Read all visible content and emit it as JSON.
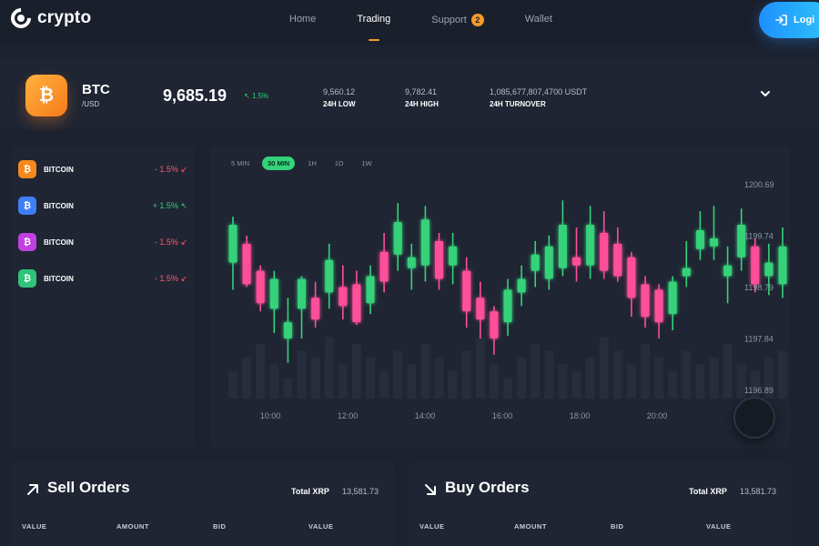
{
  "brand": {
    "name": "crypto"
  },
  "nav": {
    "items": [
      {
        "label": "Home"
      },
      {
        "label": "Trading"
      },
      {
        "label": "Support",
        "badge": "2"
      },
      {
        "label": "Wallet"
      }
    ],
    "active": "Trading"
  },
  "login": {
    "label": "Logi"
  },
  "ticker": {
    "symbol": "BTC",
    "quote": "/USD",
    "coin_icon": "bitcoin-icon",
    "price": "9,685.19",
    "change": "1.5%",
    "stats": [
      {
        "value": "9,560.12",
        "label": "24H LOW"
      },
      {
        "value": "9,782.41",
        "label": "24H HIGH"
      },
      {
        "value": "1,085,677,807,4700 USDT",
        "label": "24H TURNOVER"
      }
    ]
  },
  "watchlist": [
    {
      "name": "BITCOIN",
      "change": "- 1.5%",
      "direction": "down",
      "color": "#f5891f"
    },
    {
      "name": "BITCOIN",
      "change": "+ 1.5%",
      "direction": "up",
      "color": "#3f7ff5"
    },
    {
      "name": "BITCOIN",
      "change": "- 1.5%",
      "direction": "down",
      "color": "#c23fe0"
    },
    {
      "name": "BITCOIN",
      "change": "- 1.5%",
      "direction": "down",
      "color": "#2fc47a"
    }
  ],
  "timeframes": [
    "5 MIN",
    "30 MIN",
    "1H",
    "1D",
    "1W"
  ],
  "active_timeframe": "30 MIN",
  "colors": {
    "up": "#34d27a",
    "down": "#ff4f9a",
    "accent": "#f59a2a",
    "login": "#1e90ff"
  },
  "chart_data": {
    "type": "candlestick",
    "y_ticks": [
      "1200.69",
      "1199.74",
      "1198.79",
      "1197.84",
      "1196.89"
    ],
    "ylim": [
      1196.89,
      1200.69
    ],
    "x_ticks": [
      "10:00",
      "12:00",
      "14:00",
      "16:00",
      "18:00",
      "20:00"
    ],
    "candles": [
      {
        "open": 1199.25,
        "high": 1200.1,
        "low": 1198.75,
        "close": 1199.95
      },
      {
        "open": 1199.6,
        "high": 1199.75,
        "low": 1198.8,
        "close": 1198.85
      },
      {
        "open": 1199.1,
        "high": 1199.2,
        "low": 1198.35,
        "close": 1198.5
      },
      {
        "open": 1198.4,
        "high": 1199.1,
        "low": 1197.95,
        "close": 1198.95
      },
      {
        "open": 1197.85,
        "high": 1198.6,
        "low": 1197.4,
        "close": 1198.15
      },
      {
        "open": 1198.4,
        "high": 1199.0,
        "low": 1197.85,
        "close": 1198.95
      },
      {
        "open": 1198.6,
        "high": 1198.9,
        "low": 1198.05,
        "close": 1198.2
      },
      {
        "open": 1198.7,
        "high": 1199.6,
        "low": 1198.4,
        "close": 1199.3
      },
      {
        "open": 1198.8,
        "high": 1199.2,
        "low": 1198.2,
        "close": 1198.45
      },
      {
        "open": 1198.85,
        "high": 1199.1,
        "low": 1198.1,
        "close": 1198.15
      },
      {
        "open": 1198.5,
        "high": 1199.2,
        "low": 1198.3,
        "close": 1199.0
      },
      {
        "open": 1199.45,
        "high": 1199.8,
        "low": 1198.7,
        "close": 1198.9
      },
      {
        "open": 1199.4,
        "high": 1200.35,
        "low": 1199.1,
        "close": 1200.0
      },
      {
        "open": 1199.15,
        "high": 1199.6,
        "low": 1198.75,
        "close": 1199.35
      },
      {
        "open": 1199.2,
        "high": 1200.3,
        "low": 1198.9,
        "close": 1200.05
      },
      {
        "open": 1199.65,
        "high": 1199.8,
        "low": 1198.75,
        "close": 1198.95
      },
      {
        "open": 1199.2,
        "high": 1199.8,
        "low": 1198.85,
        "close": 1199.55
      },
      {
        "open": 1199.1,
        "high": 1199.35,
        "low": 1198.05,
        "close": 1198.35
      },
      {
        "open": 1198.6,
        "high": 1198.9,
        "low": 1197.85,
        "close": 1198.2
      },
      {
        "open": 1198.35,
        "high": 1198.45,
        "low": 1197.55,
        "close": 1197.85
      },
      {
        "open": 1198.15,
        "high": 1198.95,
        "low": 1197.9,
        "close": 1198.75
      },
      {
        "open": 1198.7,
        "high": 1199.2,
        "low": 1198.45,
        "close": 1198.95
      },
      {
        "open": 1199.1,
        "high": 1199.65,
        "low": 1198.8,
        "close": 1199.4
      },
      {
        "open": 1198.95,
        "high": 1199.75,
        "low": 1198.75,
        "close": 1199.55
      },
      {
        "open": 1199.15,
        "high": 1200.4,
        "low": 1199.0,
        "close": 1199.95
      },
      {
        "open": 1199.35,
        "high": 1199.9,
        "low": 1198.9,
        "close": 1199.2
      },
      {
        "open": 1199.2,
        "high": 1200.3,
        "low": 1198.95,
        "close": 1199.95
      },
      {
        "open": 1199.8,
        "high": 1200.2,
        "low": 1198.95,
        "close": 1199.1
      },
      {
        "open": 1199.6,
        "high": 1199.9,
        "low": 1198.9,
        "close": 1199.0
      },
      {
        "open": 1199.35,
        "high": 1199.45,
        "low": 1198.25,
        "close": 1198.6
      },
      {
        "open": 1198.85,
        "high": 1199.0,
        "low": 1198.05,
        "close": 1198.25
      },
      {
        "open": 1198.75,
        "high": 1198.85,
        "low": 1197.85,
        "close": 1198.15
      },
      {
        "open": 1198.3,
        "high": 1199.0,
        "low": 1198.0,
        "close": 1198.9
      },
      {
        "open": 1199.0,
        "high": 1199.65,
        "low": 1198.8,
        "close": 1199.15
      },
      {
        "open": 1199.5,
        "high": 1200.2,
        "low": 1199.3,
        "close": 1199.85
      },
      {
        "open": 1199.55,
        "high": 1200.3,
        "low": 1199.3,
        "close": 1199.7
      },
      {
        "open": 1199.0,
        "high": 1199.55,
        "low": 1198.5,
        "close": 1199.2
      },
      {
        "open": 1199.35,
        "high": 1200.25,
        "low": 1199.1,
        "close": 1199.95
      },
      {
        "open": 1199.55,
        "high": 1199.7,
        "low": 1198.7,
        "close": 1198.85
      },
      {
        "open": 1199.0,
        "high": 1199.6,
        "low": 1198.65,
        "close": 1199.25
      },
      {
        "open": 1198.85,
        "high": 1199.9,
        "low": 1198.6,
        "close": 1199.55
      }
    ],
    "volume": [
      4,
      6,
      8,
      5,
      3,
      7,
      6,
      9,
      5,
      8,
      6,
      4,
      7,
      5,
      8,
      6,
      4,
      7,
      9,
      5,
      3,
      6,
      8,
      7,
      5,
      4,
      6,
      9,
      7,
      5,
      8,
      6,
      4,
      7,
      5,
      6,
      8,
      5,
      4,
      6,
      7
    ]
  },
  "sell_orders": {
    "title": "Sell Orders",
    "total_label": "Total XRP",
    "total_value": "13,581.73",
    "columns": [
      "VALUE",
      "AMOUNT",
      "BID",
      "VALUE"
    ]
  },
  "buy_orders": {
    "title": "Buy Orders",
    "total_label": "Total XRP",
    "total_value": "13,581.73",
    "columns": [
      "VALUE",
      "AMOUNT",
      "BID",
      "VALUE"
    ]
  }
}
